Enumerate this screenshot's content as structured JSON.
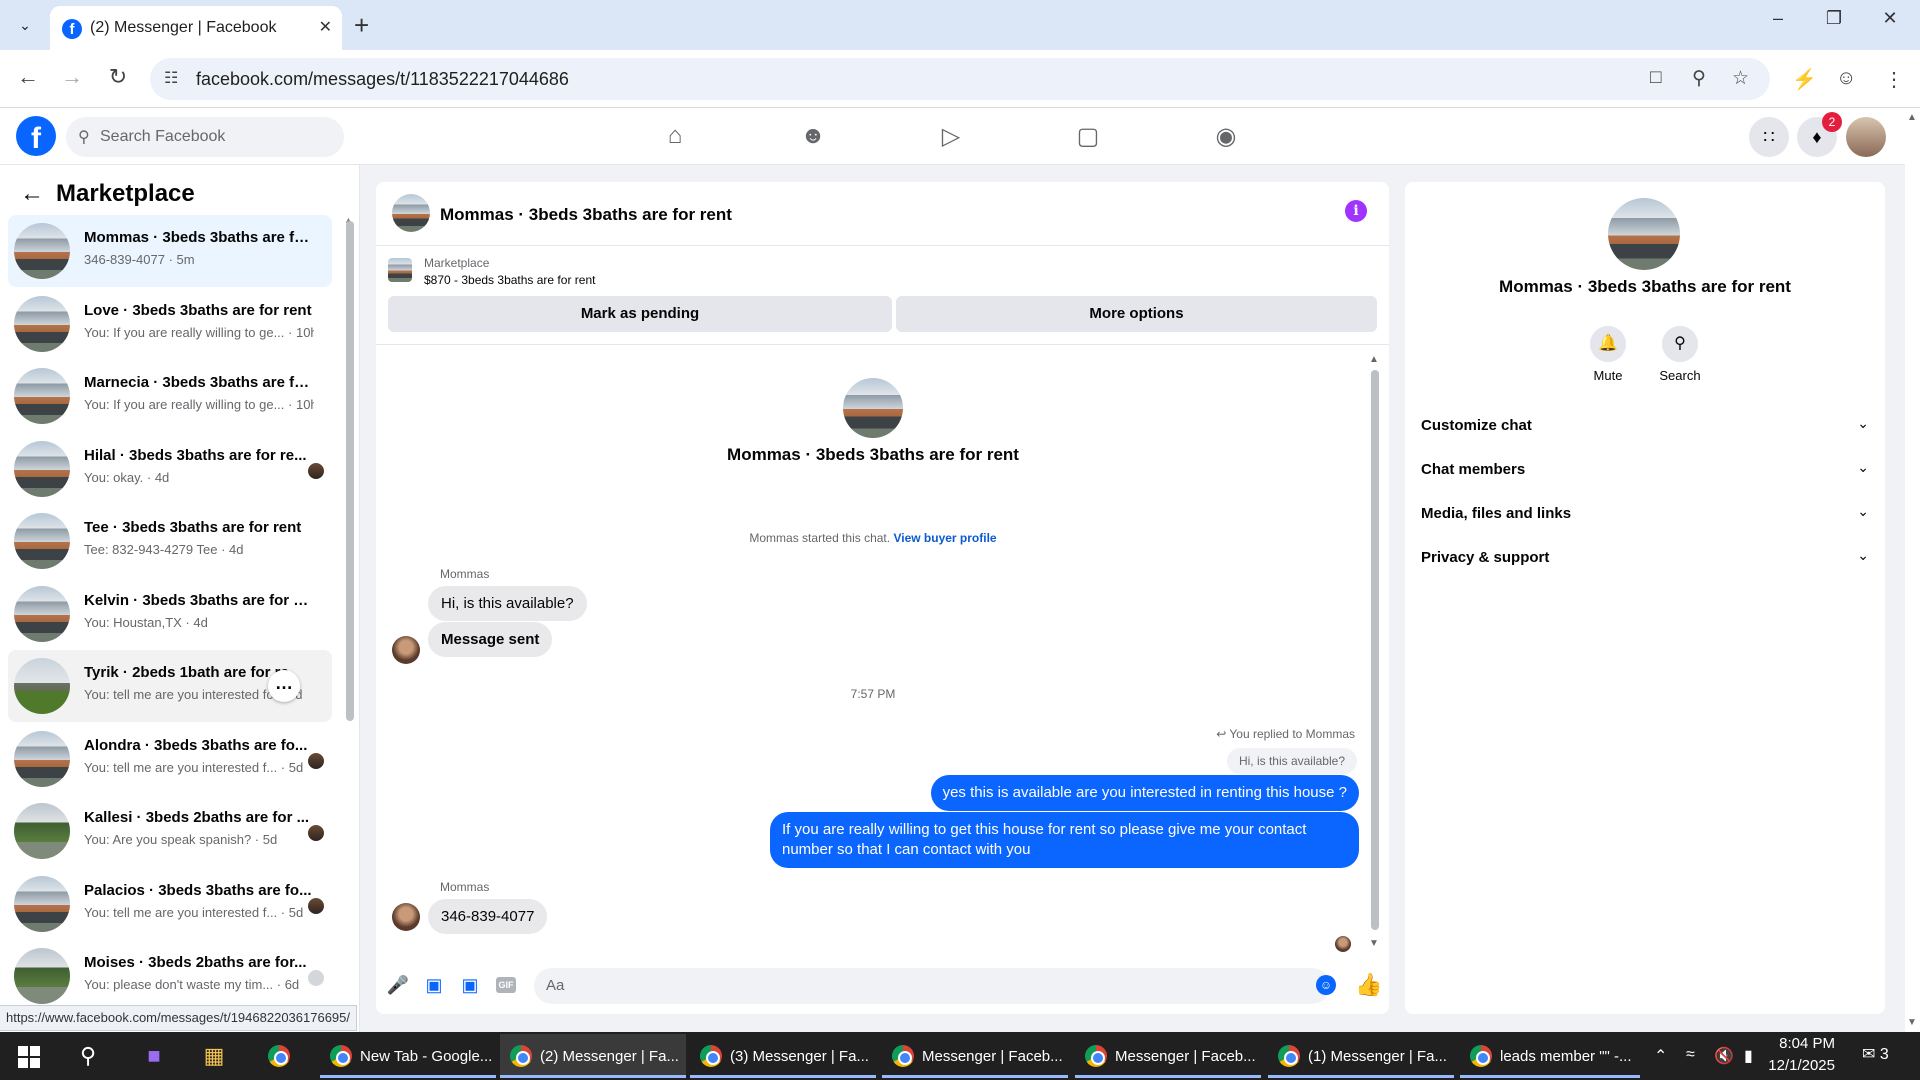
{
  "browser": {
    "tab_title": "(2) Messenger | Facebook",
    "url": "facebook.com/messages/t/1183522217044686",
    "status_url": "https://www.facebook.com/messages/t/1946822036176695/"
  },
  "fb": {
    "search_placeholder": "Search Facebook",
    "notification_count": "2"
  },
  "left": {
    "title": "Marketplace",
    "conversations": [
      {
        "name": "Mommas · 3beds 3baths are for...",
        "snippet": "346-839-4077 · 5m",
        "thumb": "house",
        "selected": true
      },
      {
        "name": "Love · 3beds 3baths are for rent",
        "snippet": "You: If you are really willing to ge... · 10h",
        "thumb": "house"
      },
      {
        "name": "Marnecia · 3beds 3baths are for...",
        "snippet": "You: If you are really willing to ge... · 10h",
        "thumb": "house"
      },
      {
        "name": "Hilal · 3beds 3baths are for re...",
        "snippet": "You: okay. · 4d",
        "thumb": "house"
      },
      {
        "name": "Tee · 3beds 3baths are for rent",
        "snippet": "Tee: 832-943-4279 Tee · 4d",
        "thumb": "house"
      },
      {
        "name": "Kelvin · 3beds 3baths are for rent",
        "snippet": "You: Houstan,TX · 4d",
        "thumb": "house"
      },
      {
        "name": "Tyrik · 2beds 1bath are for re",
        "snippet": "You: tell me are you interested fo... 5d",
        "thumb": "lawn"
      },
      {
        "name": "Alondra · 3beds 3baths are fo...",
        "snippet": "You: tell me are you interested f... · 5d",
        "thumb": "house"
      },
      {
        "name": "Kallesi · 3beds 2baths are for ...",
        "snippet": "You: Are you speak spanish? · 5d",
        "thumb": "trees"
      },
      {
        "name": "Palacios · 3beds 3baths are fo...",
        "snippet": "You: tell me are you interested f... · 5d",
        "thumb": "house"
      },
      {
        "name": "Moises · 3beds 2baths are for...",
        "snippet": "You: please don't waste my tim... · 6d",
        "thumb": "trees"
      }
    ]
  },
  "chat": {
    "title": "Mommas · 3beds 3baths are for rent",
    "marketplace_label": "Marketplace",
    "listing": "$870 - 3beds 3baths are for rent",
    "btn_pending": "Mark as pending",
    "btn_more": "More options",
    "profile_name": "Mommas · 3beds 3baths are for rent",
    "started_text": "Mommas started this chat.",
    "view_buyer": "View buyer profile",
    "sender1": "Mommas",
    "msg1": "Hi, is this available?",
    "msg2": "Message sent",
    "timestamp": "7:57 PM",
    "replied_to": "You replied to Mommas",
    "quoted": "Hi, is this available?",
    "out1": "yes this is available are you interested in renting this house ?",
    "out2": "If you are really willing to get this house for rent so please give me your contact number so that I can  contact with you",
    "sender2": "Mommas",
    "msg3": "346-839-4077",
    "composer_placeholder": "Aa"
  },
  "right": {
    "name": "Mommas · 3beds 3baths are for rent",
    "mute": "Mute",
    "search": "Search",
    "sections": [
      "Customize chat",
      "Chat members",
      "Media, files and links",
      "Privacy & support"
    ]
  },
  "taskbar": {
    "apps": [
      {
        "label": "New Tab - Google..."
      },
      {
        "label": "(2) Messenger | Fa..."
      },
      {
        "label": "(3) Messenger | Fa..."
      },
      {
        "label": "Messenger | Faceb..."
      },
      {
        "label": "Messenger | Faceb..."
      },
      {
        "label": "(1) Messenger | Fa..."
      },
      {
        "label": "leads member \"\" -..."
      }
    ],
    "time": "8:04 PM",
    "date": "12/1/2025",
    "notif_count": "3"
  }
}
